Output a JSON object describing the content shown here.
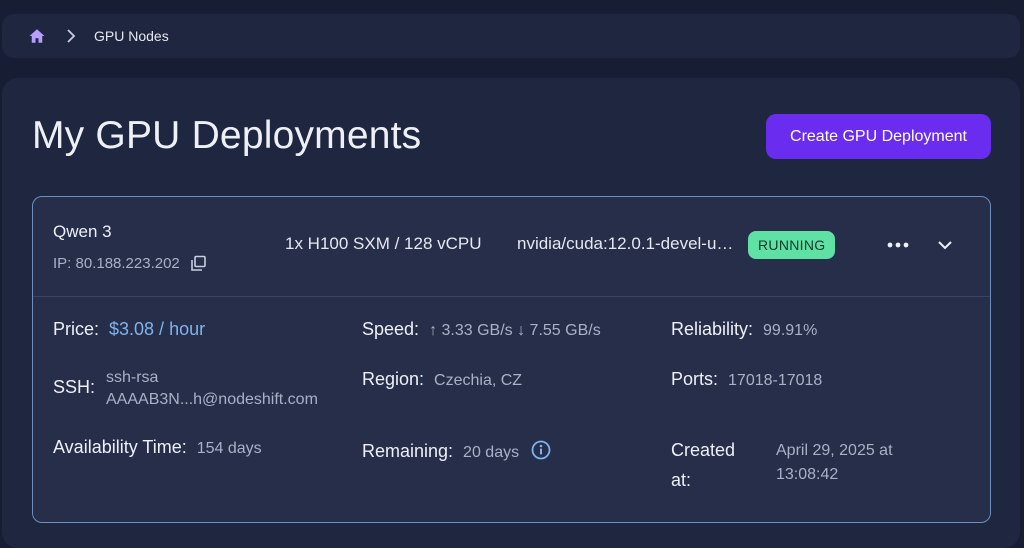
{
  "breadcrumb": {
    "home_icon": "home-icon",
    "separator_icon": "chevron-right-icon",
    "current": "GPU Nodes"
  },
  "page": {
    "title": "My GPU Deployments",
    "create_button": "Create GPU Deployment"
  },
  "deployment": {
    "name": "Qwen 3",
    "ip": "IP: 80.188.223.202",
    "spec": "1x H100 SXM / 128 vCPU",
    "image": "nvidia/cuda:12.0.1-devel-ubuntu22.04",
    "status": "RUNNING",
    "details": {
      "price_label": "Price:",
      "price_value": "$3.08 / hour",
      "speed_label": "Speed:",
      "speed_value": "↑ 3.33 GB/s ↓ 7.55 GB/s",
      "reliability_label": "Reliability:",
      "reliability_value": "99.91%",
      "ssh_label": "SSH:",
      "ssh_line1": "ssh-rsa",
      "ssh_line2": "AAAAB3N...h@nodeshift.com",
      "region_label": "Region:",
      "region_value": "Czechia, CZ",
      "ports_label": "Ports:",
      "ports_value": "17018-17018",
      "availability_label": "Availability Time:",
      "availability_value": "154 days",
      "remaining_label": "Remaining:",
      "remaining_value": "20 days",
      "created_label_line1": "Created",
      "created_label_line2": "at:",
      "created_value_line1": "April 29, 2025 at",
      "created_value_line2": "13:08:42"
    }
  },
  "colors": {
    "accent": "#6a2df0",
    "status_running": "#5fe0a4",
    "price": "#7fb3ec"
  }
}
